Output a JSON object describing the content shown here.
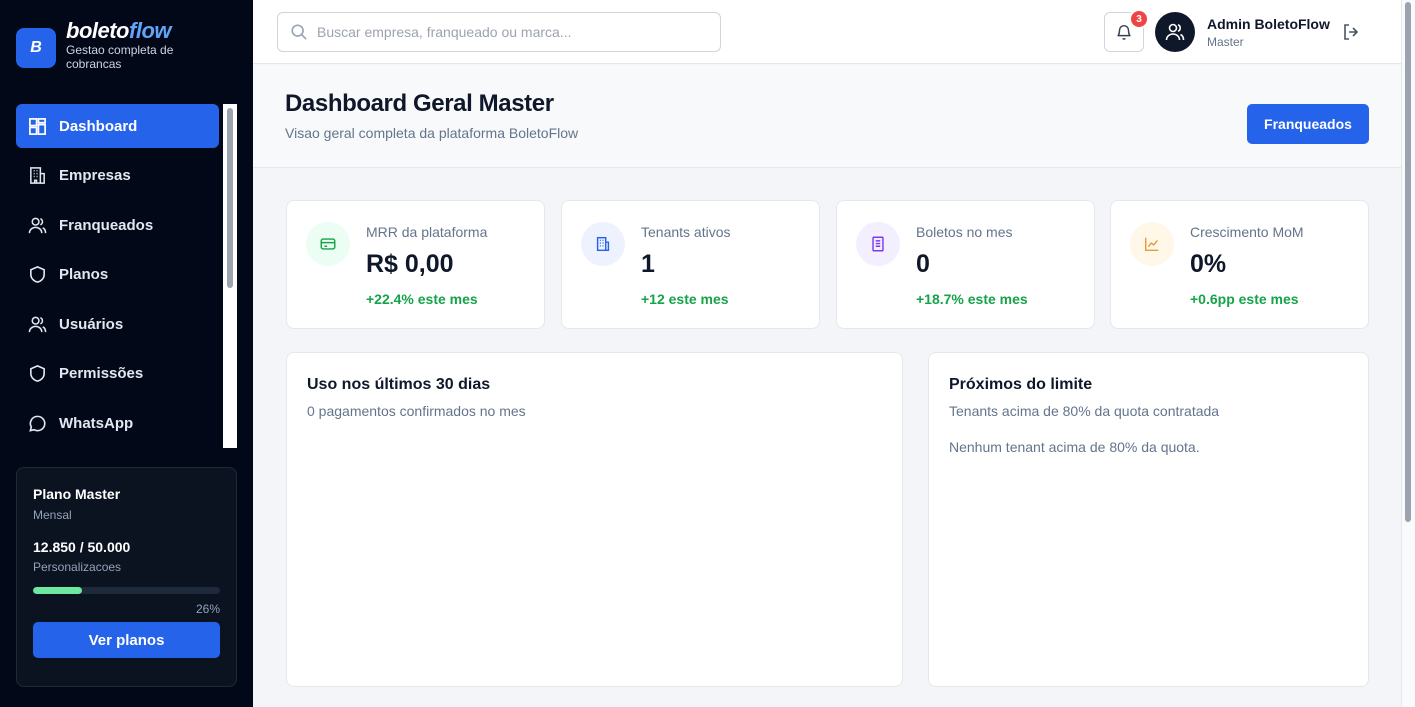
{
  "brand": {
    "logo_letter": "B",
    "name_part1": "boleto",
    "name_part2": "flow",
    "tagline": "Gestao completa de cobrancas"
  },
  "sidebar": {
    "items": [
      {
        "label": "Dashboard",
        "icon": "dashboard-icon",
        "active": true
      },
      {
        "label": "Empresas",
        "icon": "building-icon"
      },
      {
        "label": "Franqueados",
        "icon": "users-icon"
      },
      {
        "label": "Planos",
        "icon": "shield-icon"
      },
      {
        "label": "Usuários",
        "icon": "users-icon"
      },
      {
        "label": "Permissões",
        "icon": "shield-icon"
      },
      {
        "label": "WhatsApp",
        "icon": "chat-bubble-icon"
      }
    ],
    "plan": {
      "title": "Plano Master",
      "period": "Mensal",
      "count": "12.850 / 50.000",
      "count_label": "Personalizacoes",
      "progress": 0.26,
      "percent_text": "26%",
      "button": "Ver planos"
    }
  },
  "topbar": {
    "search_placeholder": "Buscar empresa, franqueado ou marca...",
    "notifications_count": "3",
    "user_name": "Admin BoletoFlow",
    "user_role": "Master"
  },
  "header": {
    "title": "Dashboard Geral Master",
    "subtitle": "Visao geral completa da plataforma BoletoFlow",
    "button": "Franqueados"
  },
  "stats": [
    {
      "label": "MRR da plataforma",
      "value": "R$ 0,00",
      "delta": "+22.4% este mes",
      "icon": "card-icon",
      "color": "#16a34a",
      "bg": "#ecfdf3"
    },
    {
      "label": "Tenants ativos",
      "value": "1",
      "delta": "+12 este mes",
      "icon": "building-icon",
      "color": "#2563eb",
      "bg": "#eef2ff"
    },
    {
      "label": "Boletos no mes",
      "value": "0",
      "delta": "+18.7% este mes",
      "icon": "document-icon",
      "color": "#7c3aed",
      "bg": "#f3efff"
    },
    {
      "label": "Crescimento MoM",
      "value": "0%",
      "delta": "+0.6pp este mes",
      "icon": "chart-icon",
      "color": "#ea9a3c",
      "bg": "#fff7e8"
    }
  ],
  "usage_panel": {
    "title": "Uso nos últimos 30 dias",
    "subtitle": "0 pagamentos confirmados no mes"
  },
  "limits_panel": {
    "title": "Próximos do limite",
    "subtitle": "Tenants acima de 80% da quota contratada",
    "empty_text": "Nenhum tenant acima de 80% da quota."
  },
  "colors": {
    "accent": "#2563eb",
    "sidebar_bg": "#020817",
    "success": "#16a34a",
    "badge": "#ef4444"
  }
}
